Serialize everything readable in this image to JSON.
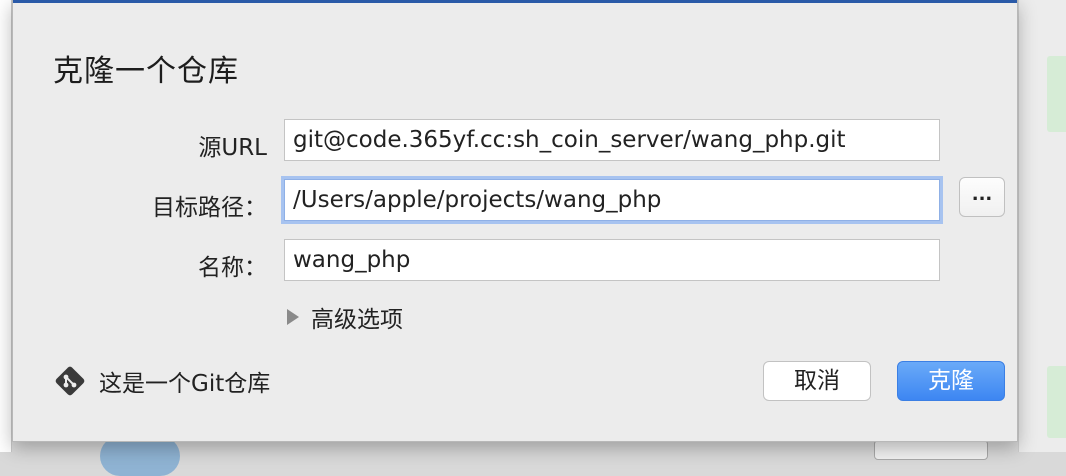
{
  "dialog": {
    "title": "克隆一个仓库"
  },
  "form": {
    "source_url": {
      "label": "源URL",
      "value": "git@code.365yf.cc:sh_coin_server/wang_php.git"
    },
    "target_path": {
      "label": "目标路径：",
      "value": "/Users/apple/projects/wang_php",
      "browse_label": "..."
    },
    "name": {
      "label": "名称：",
      "value": "wang_php"
    },
    "advanced_options_label": "高级选项"
  },
  "footer": {
    "repo_status": "这是一个Git仓库",
    "cancel_label": "取消",
    "clone_label": "克隆"
  },
  "icons": {
    "git": "git-diamond-icon",
    "disclosure": "disclosure-triangle-icon"
  },
  "colors": {
    "accent": "#3d86f2",
    "focus_ring": "#a7c3f0",
    "dialog_bg": "#ececec"
  }
}
